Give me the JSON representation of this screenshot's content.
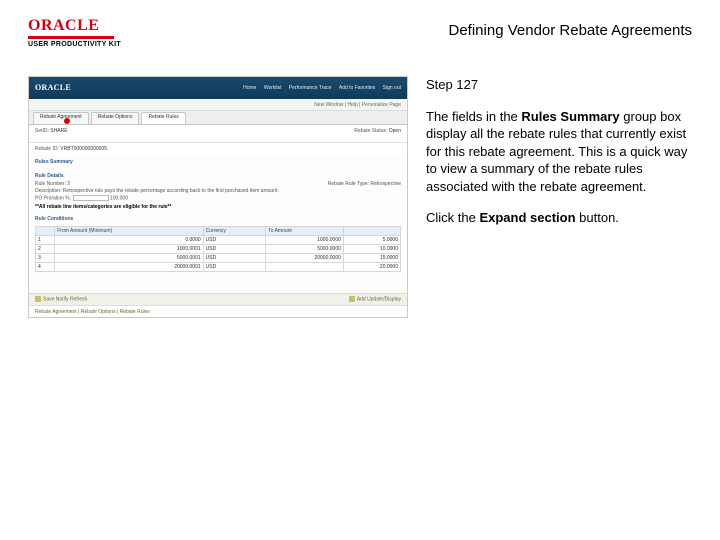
{
  "brand": {
    "name": "ORACLE",
    "subtitle": "USER PRODUCTIVITY KIT"
  },
  "page_title": "Defining Vendor Rebate Agreements",
  "instruction": {
    "step_label": "Step 127",
    "paragraph_prefix": "The fields in the ",
    "paragraph_bold1": "Rules Summary",
    "paragraph_mid": " group box display all the rebate rules that currently exist for this rebate agreement. This is a quick way to view a summary of the rebate rules associated with the rebate agreement.",
    "click_prefix": "Click the ",
    "click_bold": "Expand section",
    "click_suffix": " button."
  },
  "shot": {
    "brand": "ORACLE",
    "nav": [
      "Home",
      "Worklist",
      "Performance Trace",
      "Add to Favorites",
      "Sign out"
    ],
    "breadcrumb": "New Window | Help | Personalize Page",
    "tabs": [
      "Rebate Agreement",
      "Rebate Options",
      "Rebate Rules"
    ],
    "setid_label": "SetID:",
    "setid_value": "SHARE",
    "status_label": "Rebate Status:",
    "status_value": "Open",
    "rebateid_label": "Rebate ID:",
    "rebateid_value": "VRBT000000000005",
    "rules_summary": "Rules Summary",
    "rule_details": "Rule Details",
    "rule_number_label": "Rule Number:",
    "rule_number_value": "2",
    "rule_type_label": "Rebate Rule Type:",
    "rule_type_value": "Retrospective",
    "desc_label": "Description:",
    "desc_value": "Retrospective rule pays the rebate percentage according back to the first purchased item amount.",
    "proration_label": "PO Proration %:",
    "proration_value": "100.000",
    "eligibility": "**All rebate line items/categories are eligible for the rule**",
    "rule_conditions": "Rule Conditions",
    "table": {
      "headers": [
        "",
        "From Amount (Minimum)",
        "Currency",
        "To Amount",
        ""
      ],
      "rows": [
        [
          "1",
          "0.0000",
          "USD",
          "1000.0000",
          "5.0000"
        ],
        [
          "2",
          "1000.0001",
          "USD",
          "5000.0000",
          "10.0000"
        ],
        [
          "3",
          "5000.0001",
          "USD",
          "20000.0000",
          "15.0000"
        ],
        [
          "4",
          "20000.0001",
          "USD",
          "",
          "20.0000"
        ]
      ]
    },
    "footer1_left": "Save   Notify   Refresh",
    "footer1_right": "Add    Update/Display",
    "footer2": "Rebate Agreement | Rebate Options | Rebate Rules"
  }
}
